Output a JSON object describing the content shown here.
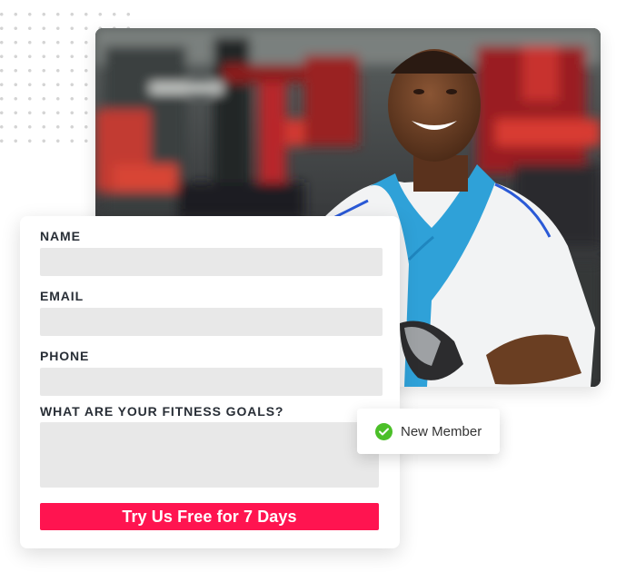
{
  "form": {
    "fields": [
      {
        "label": "NAME",
        "value": "",
        "placeholder": ""
      },
      {
        "label": "EMAIL",
        "value": "",
        "placeholder": ""
      },
      {
        "label": "PHONE",
        "value": "",
        "placeholder": ""
      }
    ],
    "goals": {
      "label": "WHAT ARE YOUR FITNESS GOALS?",
      "value": "",
      "placeholder": ""
    },
    "submit_label": "Try Us Free for 7 Days"
  },
  "badge": {
    "text": "New Member",
    "icon": "check-circle-icon"
  },
  "photo": {
    "subject": "smiling man with blue towel in gym"
  },
  "colors": {
    "accent": "#ff1450",
    "success": "#4bbf28",
    "label": "#282e36",
    "input_bg": "#e8e8e8"
  }
}
